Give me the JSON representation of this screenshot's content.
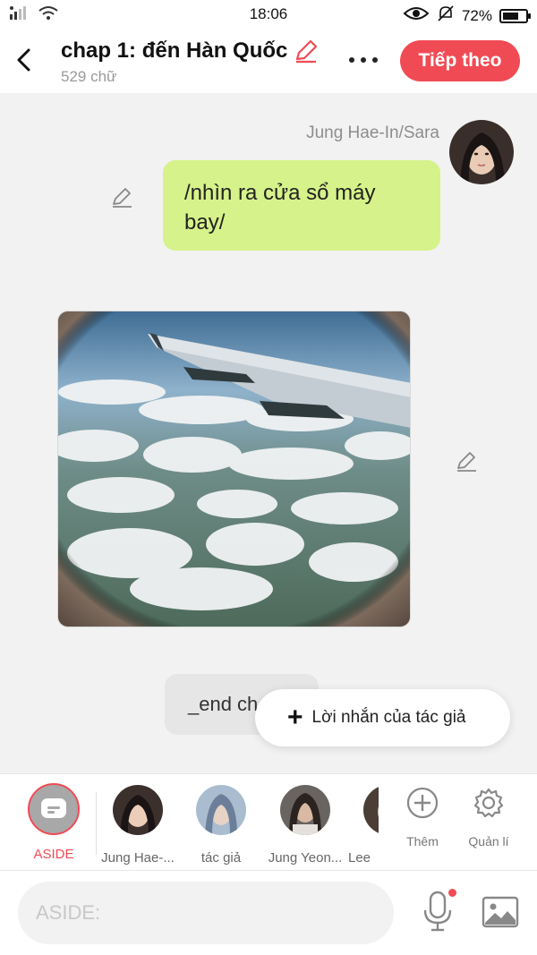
{
  "status": {
    "time": "18:06",
    "battery": "72%",
    "battery_level": 0.72
  },
  "header": {
    "title": "chap 1: đến Hàn Quốc",
    "word_count": "529 chữ",
    "next_label": "Tiếp theo"
  },
  "chat": {
    "sender_name": "Jung Hae-In/Sara",
    "message_text": "/nhìn ra cửa sổ máy bay/",
    "end_text": "_end ch",
    "popup_label": "Lời nhắn của tác giả"
  },
  "characters": {
    "aside_label": "ASIDE",
    "items": [
      {
        "label": "Jung Hae-..."
      },
      {
        "label": "tác giả"
      },
      {
        "label": "Jung Yeon..."
      },
      {
        "label": "Lee"
      }
    ],
    "add_label": "Thêm",
    "manage_label": "Quản lí"
  },
  "composer": {
    "placeholder": "ASIDE:"
  },
  "colors": {
    "accent": "#f04b55",
    "bubble": "#d6f28a"
  }
}
